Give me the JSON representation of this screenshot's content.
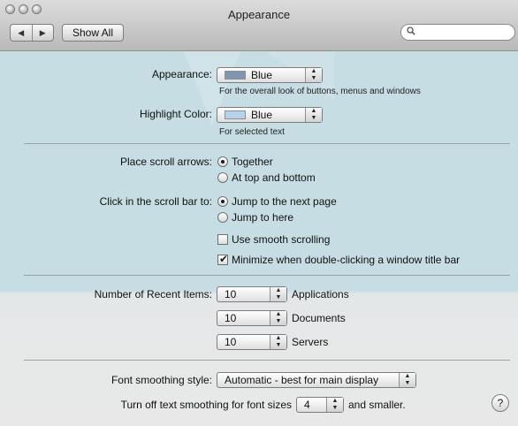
{
  "window": {
    "title": "Appearance"
  },
  "toolbar": {
    "back_glyph": "◀",
    "forward_glyph": "▶",
    "show_all_label": "Show All",
    "search_value": "",
    "search_icon": "search-icon"
  },
  "appearance": {
    "label": "Appearance:",
    "value": "Blue",
    "swatch_color": "#7f96b1",
    "hint": "For the overall look of buttons, menus and windows"
  },
  "highlight": {
    "label": "Highlight Color:",
    "value": "Blue",
    "swatch_color": "#b5d3ea",
    "hint": "For selected text"
  },
  "scroll_arrows": {
    "label": "Place scroll arrows:",
    "options": [
      "Together",
      "At top and bottom"
    ],
    "selected": "Together"
  },
  "scroll_bar_click": {
    "label": "Click in the scroll bar to:",
    "options": [
      "Jump to the next page",
      "Jump to here"
    ],
    "selected": "Jump to the next page"
  },
  "smooth_scrolling": {
    "label": "Use smooth scrolling",
    "checked": false
  },
  "minimize_double_click": {
    "label": "Minimize when double-clicking a window title bar",
    "checked": true
  },
  "recent_items": {
    "label": "Number of Recent Items:",
    "rows": [
      {
        "value": "10",
        "label": "Applications"
      },
      {
        "value": "10",
        "label": "Documents"
      },
      {
        "value": "10",
        "label": "Servers"
      }
    ]
  },
  "font_smoothing": {
    "label": "Font smoothing style:",
    "value": "Automatic - best for main display"
  },
  "text_smoothing": {
    "label": "Turn off text smoothing for font sizes",
    "value": "4",
    "suffix": "and smaller."
  },
  "help": {
    "glyph": "?"
  },
  "colors": {
    "tint": "#c5dde3",
    "separator": "#9aa4a7"
  }
}
